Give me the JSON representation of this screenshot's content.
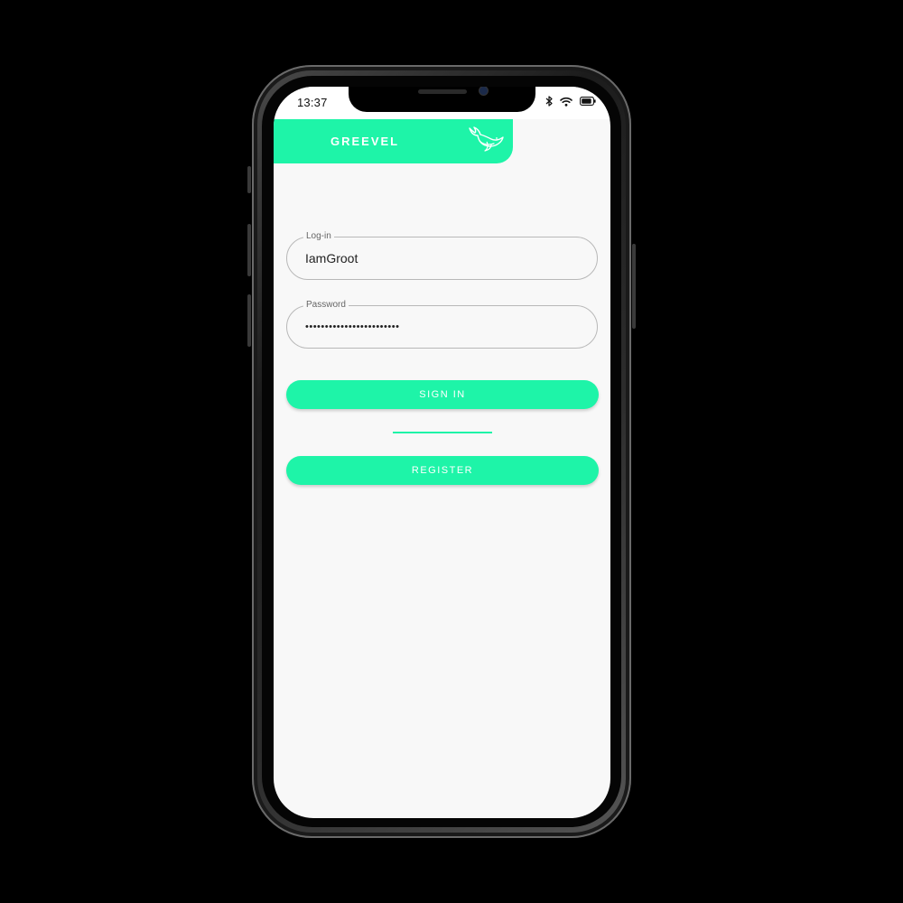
{
  "status_bar": {
    "time": "13:37",
    "icons": [
      "bluetooth-icon",
      "wifi-icon",
      "battery-icon"
    ]
  },
  "app_bar": {
    "title": "GREEVEL",
    "logo": "whale-logo-icon"
  },
  "login_form": {
    "login_label": "Log-in",
    "login_value": "IamGroot",
    "password_label": "Password",
    "password_value": "••••••••••••••••••••••••",
    "sign_in_label": "SIGN IN",
    "register_label": "REGISTER"
  },
  "colors": {
    "accent": "#1ef4a8",
    "background": "#f8f8f8",
    "field_border": "#b8b8b8"
  }
}
